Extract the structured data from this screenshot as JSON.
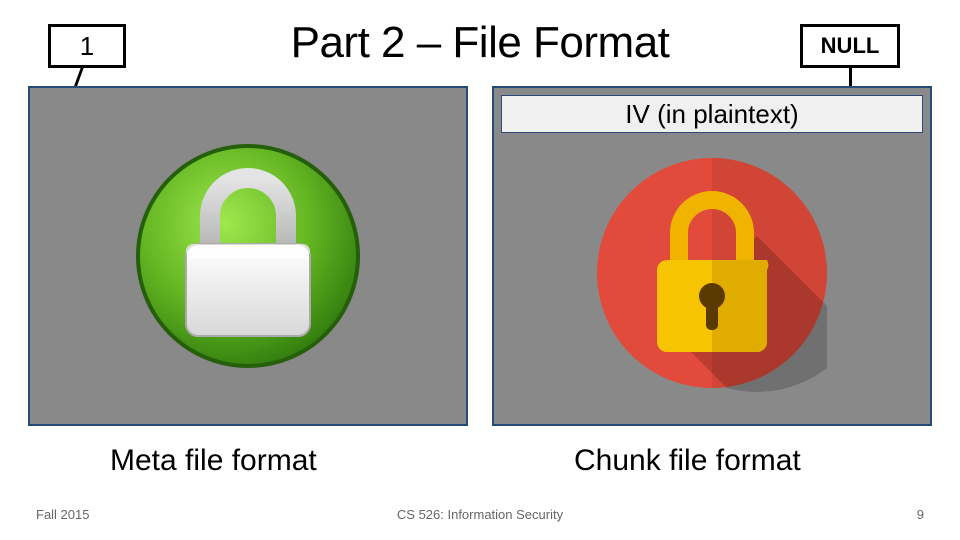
{
  "title": "Part 2 – File Format",
  "box_left": "1",
  "box_right": "NULL",
  "iv_label": "IV (in plaintext)",
  "caption_left": "Meta file format",
  "caption_right": "Chunk file format",
  "footer": {
    "left": "Fall 2015",
    "center": "CS 526: Information Security",
    "right": "9"
  }
}
